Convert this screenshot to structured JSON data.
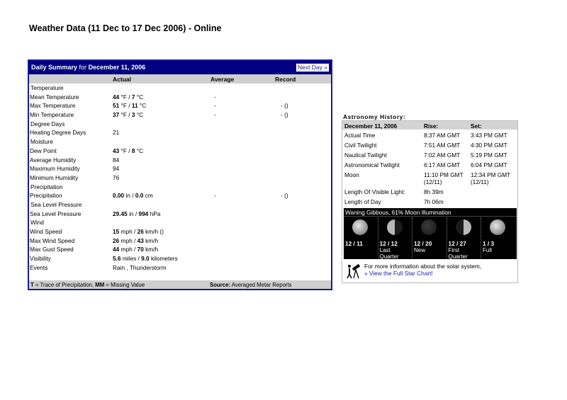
{
  "page": {
    "title": "Weather Data (11 Dec to 17 Dec 2006) - Online"
  },
  "daily_summary": {
    "heading_prefix": "Daily Summary",
    "heading_for": "for",
    "heading_date": "December 11, 2006",
    "next_day": "Next Day »",
    "columns": {
      "actual": "Actual",
      "average": "Average",
      "record": "Record"
    },
    "rows": [
      {
        "type": "sec",
        "label": "Temperature"
      },
      {
        "label": "Mean Temperature",
        "v1": "44",
        "u1": " °F / ",
        "v2": "7",
        "u2": " °C",
        "avg": "-",
        "rec": ""
      },
      {
        "label": "Max Temperature",
        "v1": "51",
        "u1": " °F / ",
        "v2": "11",
        "u2": " °C",
        "avg": "-",
        "rec": "- ()"
      },
      {
        "label": "Min Temperature",
        "v1": "37",
        "u1": " °F / ",
        "v2": "3",
        "u2": " °C",
        "avg": "-",
        "rec": "- ()"
      },
      {
        "type": "sec",
        "label": "Degree Days"
      },
      {
        "label": "Heating Degree Days",
        "plain": "21"
      },
      {
        "type": "sec",
        "label": "Moisture"
      },
      {
        "label": "Dew Point",
        "v1": "43",
        "u1": " °F / ",
        "v2": "8",
        "u2": " °C"
      },
      {
        "label": "Average Humidity",
        "plain": "84"
      },
      {
        "label": "Maximum Humidity",
        "plain": "94"
      },
      {
        "label": "Minimum Humidity",
        "plain": "76"
      },
      {
        "type": "sec",
        "label": "Precipitation"
      },
      {
        "label": "Precipitation",
        "v1": "0.00",
        "u1": " in / ",
        "v2": "0.0",
        "u2": " cm",
        "avg": "-",
        "rec": "- ()"
      },
      {
        "type": "sec",
        "label": "Sea Level Pressure"
      },
      {
        "label": "Sea Level Pressure",
        "v1": "29.45",
        "u1": " in / ",
        "v2": "994",
        "u2": " hPa"
      },
      {
        "type": "sec",
        "label": "Wind"
      },
      {
        "label": "Wind Speed",
        "v1": "15",
        "u1": " mph / ",
        "v2": "26",
        "u2": " km/h ()"
      },
      {
        "label": "Max Wind Speed",
        "v1": "26",
        "u1": " mph / ",
        "v2": "43",
        "u2": " km/h"
      },
      {
        "label": "Max Gust Speed",
        "v1": "44",
        "u1": " mph / ",
        "v2": "70",
        "u2": " km/h"
      },
      {
        "label": "Visibility",
        "v1": "5.6",
        "u1": " miles / ",
        "v2": "9.0",
        "u2": " kilometers"
      },
      {
        "label": "Events",
        "plain": "Rain , Thunderstorm"
      }
    ],
    "footer": {
      "t": "T",
      "t_desc": " = Trace of Precipitation, ",
      "mm": "MM",
      "mm_desc": " = Missing Value",
      "source_label": "Source:",
      "source_value": " Averaged Metar Reports"
    }
  },
  "astronomy": {
    "title": "Astronomy History:",
    "header": {
      "date": "December 11, 2006",
      "rise": "Rise:",
      "set": "Set:"
    },
    "rows": [
      {
        "label": "Actual Time",
        "rise": "8:37 AM GMT",
        "set": "3:43 PM GMT"
      },
      {
        "label": "Civil Twilight",
        "rise": "7:51 AM GMT",
        "set": "4:30 PM GMT"
      },
      {
        "label": "Nautical Twilight",
        "rise": "7:02 AM GMT",
        "set": "5:19 PM GMT"
      },
      {
        "label": "Astronomical Twilight",
        "rise": "6:17 AM GMT",
        "set": "6:04 PM GMT"
      },
      {
        "label": "Moon",
        "rise": "11:10 PM GMT",
        "rise2": "(12/11)",
        "set": "12:34 PM GMT",
        "set2": "(12/11)"
      },
      {
        "label": "Length Of Visible Light:",
        "rise": "8h 39m",
        "set": ""
      },
      {
        "label": "Length of Day",
        "rise": "7h 06m",
        "set": ""
      }
    ],
    "moon_caption": "Waning Gibbous, 61% Moon Illumination",
    "phases": [
      {
        "date": "12 / 11",
        "l1": "",
        "l2": ""
      },
      {
        "date": "12 / 12",
        "l1": "Last",
        "l2": "Quarter"
      },
      {
        "date": "12 / 20",
        "l1": "New",
        "l2": ""
      },
      {
        "date": "12 / 27",
        "l1": "First",
        "l2": "Quarter"
      },
      {
        "date": "1 / 3",
        "l1": "Full",
        "l2": ""
      }
    ],
    "star_text": "For more information about the solar system,",
    "star_link": "» View the Full Star Chart!"
  }
}
